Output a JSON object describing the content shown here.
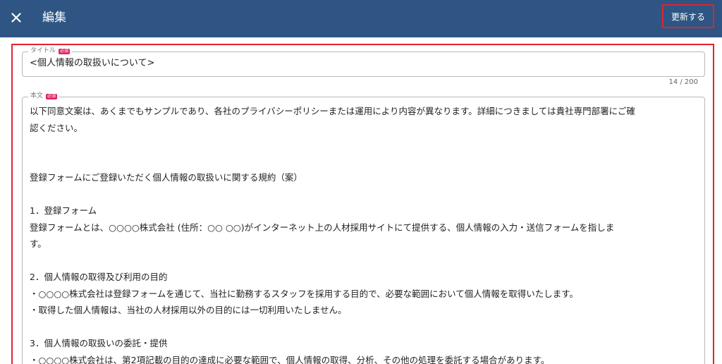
{
  "header": {
    "title": "編集",
    "update_label": "更新する",
    "close_icon": "close-icon"
  },
  "form": {
    "title_field": {
      "label": "タイトル",
      "required_badge": "必須",
      "value": "<個人情報の取扱いについて>",
      "counter": "14 / 200"
    },
    "body_field": {
      "label": "本文",
      "required_badge": "必須",
      "lines": [
        "以下同意文案は、あくまでもサンプルであり、各社のプライバシーポリシーまたは運用により内容が異なります。詳細につきましては貴社専門部署にご確",
        "認ください。",
        "",
        "",
        "登録フォームにご登録いただく個人情報の取扱いに関する規約（案）",
        "",
        "1．登録フォーム",
        "登録フォームとは、○○○○株式会社 (住所：○○ ○○)がインターネット上の人材採用サイトにて提供する、個人情報の入力・送信フォームを指しま",
        "す。",
        "",
        "2．個人情報の取得及び利用の目的",
        "・○○○○株式会社は登録フォームを通じて、当社に勤務するスタッフを採用する目的で、必要な範囲において個人情報を取得いたします。",
        "・取得した個人情報は、当社の人材採用以外の目的には一切利用いたしません。",
        "",
        "3．個人情報の取扱いの委託・提供",
        "・○○○○株式会社は、第2項記載の目的の達成に必要な範囲で、個人情報の取得、分析、その他の処理を委託する場合があります。"
      ]
    }
  }
}
